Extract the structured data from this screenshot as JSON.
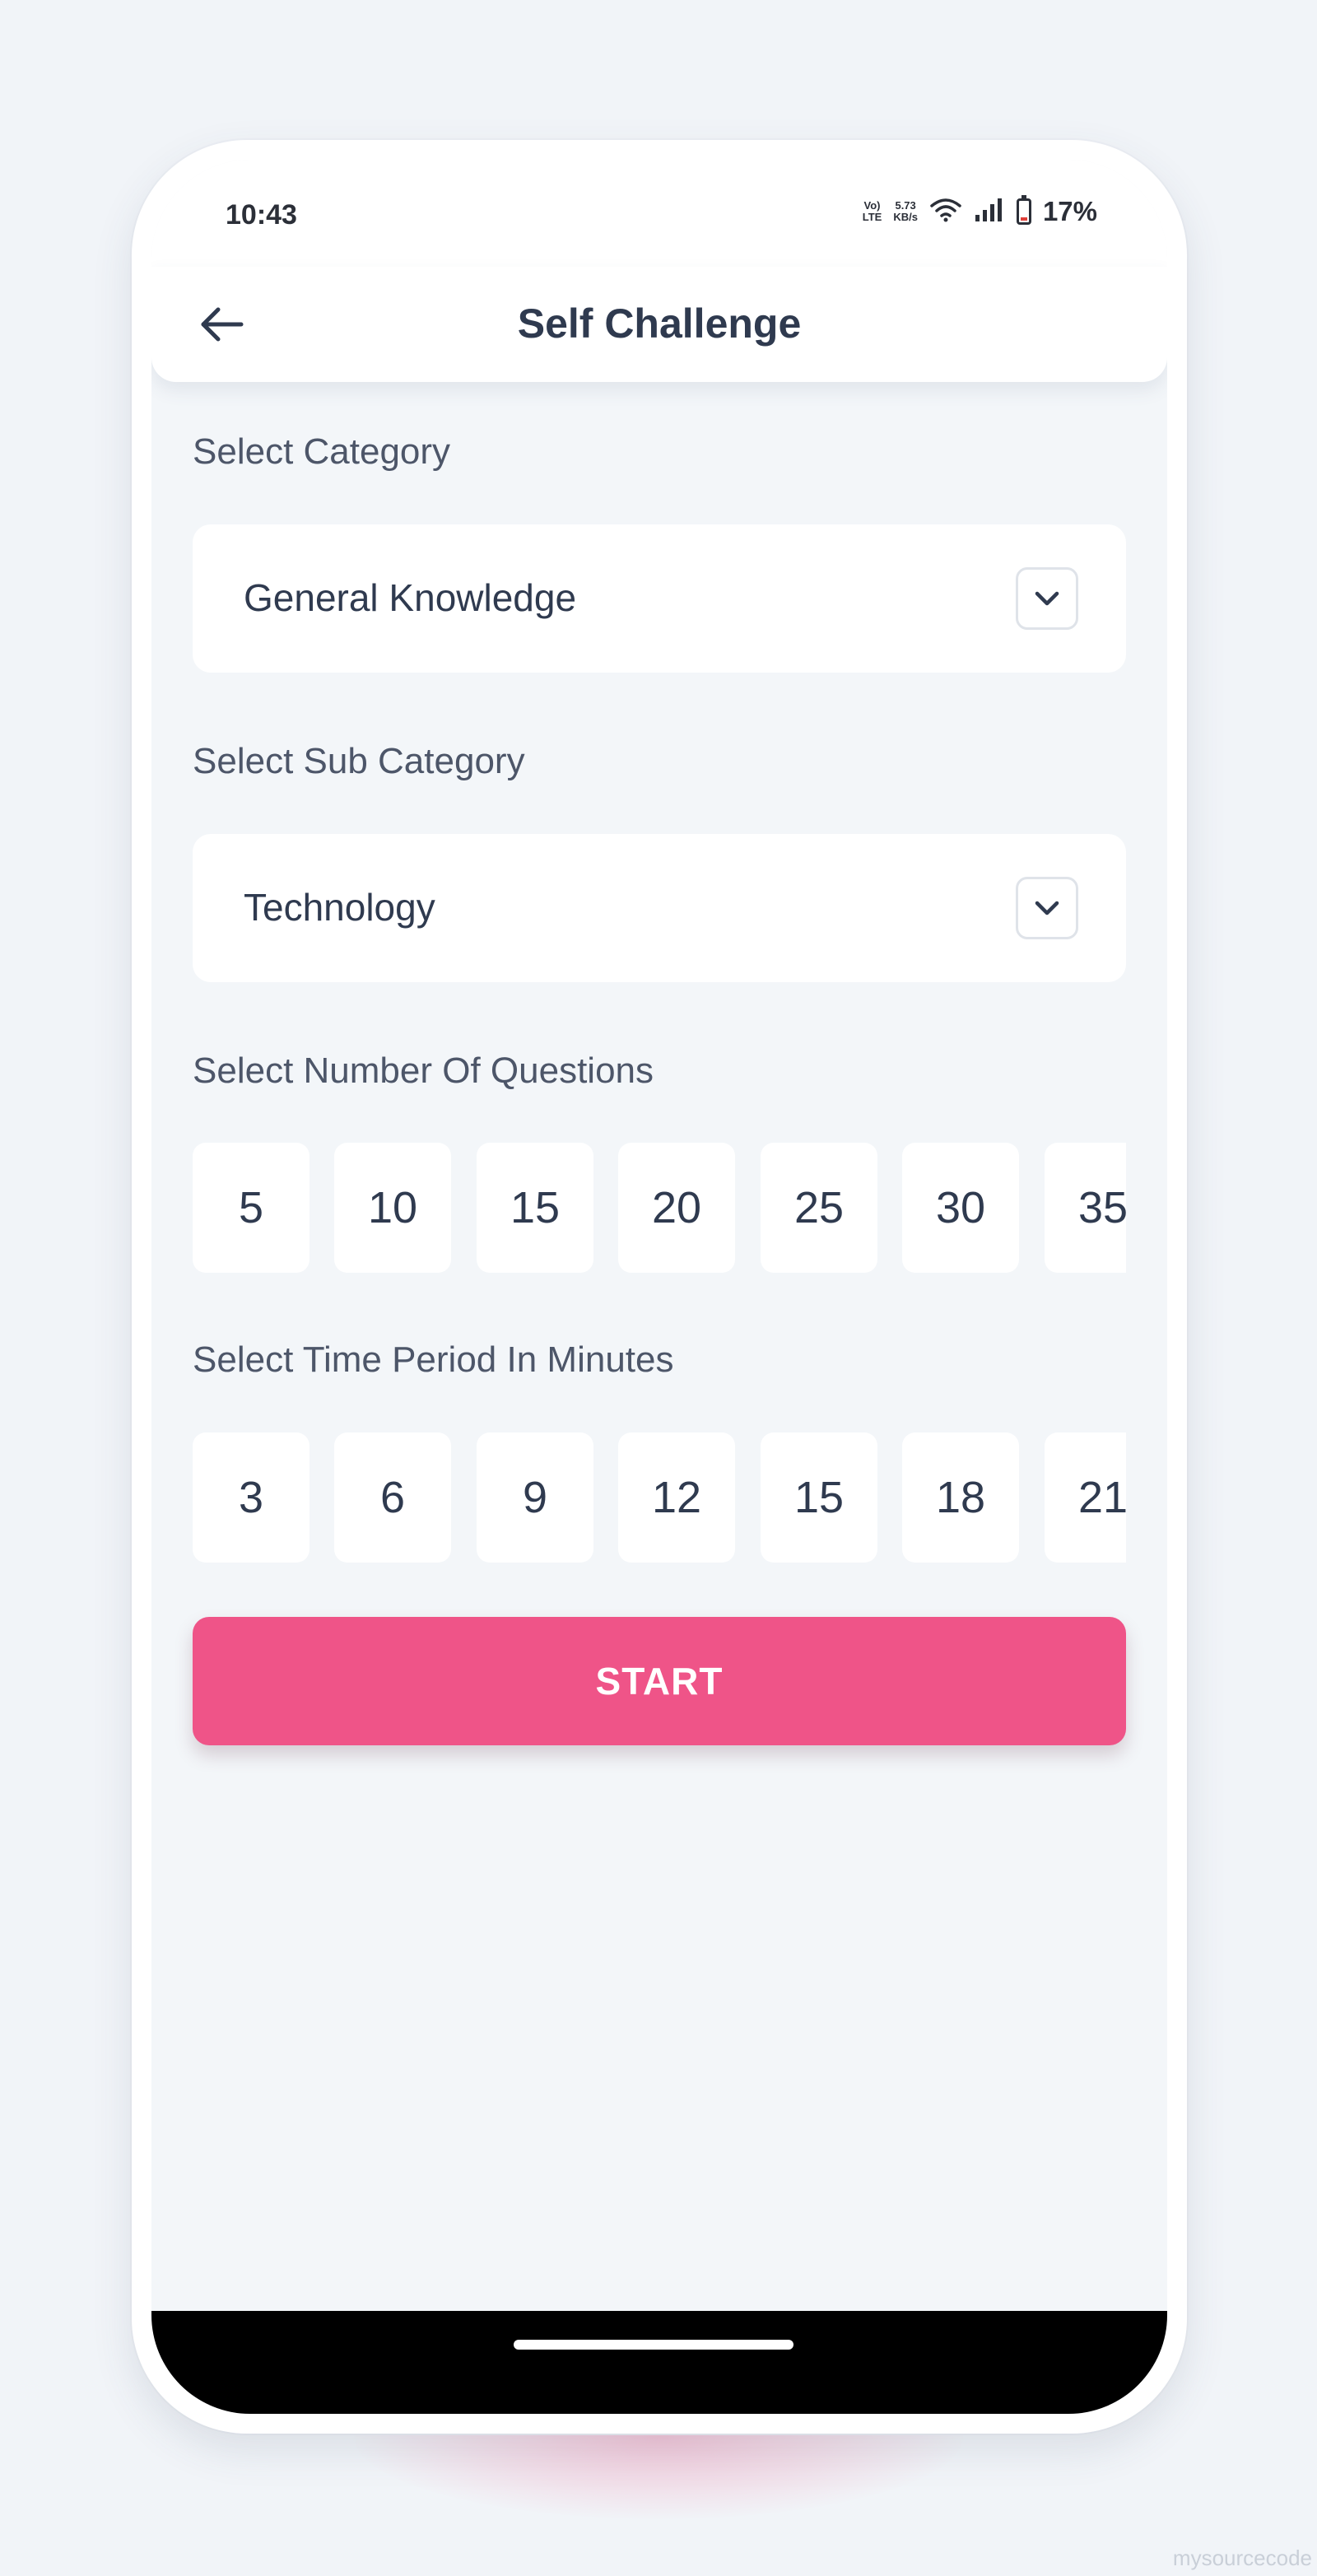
{
  "status_bar": {
    "time": "10:43",
    "network_type_top": "Vo)",
    "network_type_bottom": "LTE",
    "speed_value": "5.73",
    "speed_unit": "KB/s",
    "battery": "17%"
  },
  "header": {
    "title": "Self Challenge"
  },
  "category": {
    "label": "Select Category",
    "value": "General Knowledge"
  },
  "sub_category": {
    "label": "Select Sub Category",
    "value": "Technology"
  },
  "questions": {
    "label": "Select Number Of Questions",
    "options": [
      "5",
      "10",
      "15",
      "20",
      "25",
      "30",
      "35"
    ]
  },
  "time_period": {
    "label": "Select Time Period In Minutes",
    "options": [
      "3",
      "6",
      "9",
      "12",
      "15",
      "18",
      "21"
    ]
  },
  "start_button": {
    "label": "START",
    "color": "#ef5488"
  },
  "watermark": {
    "text": "mysourcecode"
  },
  "icons": {
    "back": "arrow-left-icon",
    "dropdown": "chevron-down-icon",
    "wifi": "wifi-icon",
    "signal": "signal-icon",
    "battery": "battery-icon"
  }
}
